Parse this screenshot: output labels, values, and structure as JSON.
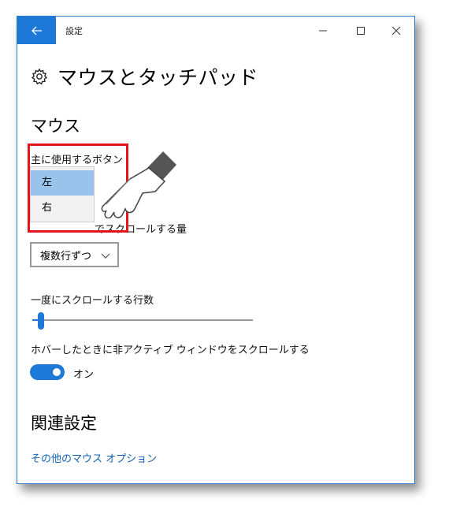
{
  "window": {
    "title": "設定"
  },
  "titlebar": {
    "back_icon": "arrow-left-icon",
    "minimize_icon": "minimize-icon",
    "maximize_icon": "maximize-icon",
    "close_icon": "close-icon"
  },
  "page": {
    "title": "マウスとタッチパッド",
    "icon": "gear-icon"
  },
  "mouse": {
    "section_title": "マウス",
    "primary_button_label": "主に使用するボタン",
    "primary_options": [
      "左",
      "右"
    ],
    "primary_selected": "左",
    "wheel_label": "でスクロールする量",
    "wheel_value": "複数行ずつ",
    "lines_label": "一度にスクロールする行数",
    "lines_slider_fraction": 0.02,
    "hover_label": "ホバーしたときに非アクティブ ウィンドウをスクロールする",
    "toggle_state": "オン"
  },
  "related": {
    "title": "関連設定",
    "link": "その他のマウス オプション"
  },
  "colors": {
    "accent": "#1e78d7",
    "highlight": "#e3151a",
    "selected_option": "#99c3ea",
    "link": "#1060b8"
  }
}
